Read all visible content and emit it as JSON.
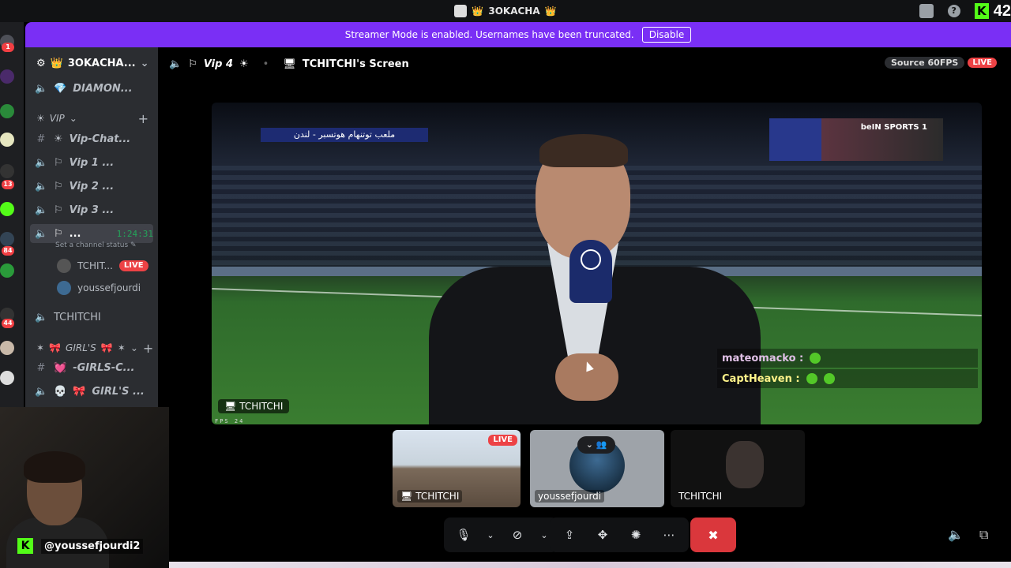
{
  "app": {
    "title": "3OKACHA",
    "notification_count": "42"
  },
  "banner": {
    "message": "Streamer Mode is enabled. Usernames have been truncated.",
    "disable_label": "Disable"
  },
  "guild_rail": {
    "badges": [
      "1",
      "13",
      "84",
      "44"
    ]
  },
  "sidebar": {
    "server_name": "3OKACHA...",
    "channels": [
      {
        "label": "DIAMON...",
        "icon": "speaker-icon"
      },
      {
        "label": "Vip-Chat...",
        "icon": "hash-icon"
      },
      {
        "label": "Vip 1 ...",
        "icon": "speaker-icon"
      },
      {
        "label": "Vip 2 ...",
        "icon": "speaker-icon"
      },
      {
        "label": "Vip 3 ...",
        "icon": "speaker-icon"
      },
      {
        "label": "...",
        "icon": "speaker-icon",
        "timer": "1:24:31"
      },
      {
        "label": "TCHITCHI",
        "icon": "speaker-icon"
      },
      {
        "label": "-GIRLS-C...",
        "icon": "hash-icon"
      },
      {
        "label": "GIRL'S ...",
        "icon": "speaker-icon"
      }
    ],
    "categories": [
      "VIP",
      "GIRL'S"
    ],
    "channel_status": "Set a channel status",
    "voice_users": [
      {
        "name": "TCHIT...",
        "live": "LIVE"
      },
      {
        "name": "youssefjourdi"
      }
    ]
  },
  "stage": {
    "channel": "Vip 4",
    "screen_title": "TCHITCHI's Screen",
    "quality": "Source 60FPS",
    "live_label": "LIVE"
  },
  "video": {
    "caption": "ملعب توتنهام هوتسبر - لندن",
    "tv_logo": "beIN SPORTS 1",
    "tag": "TCHITCHI",
    "fps_label": "FPS 24",
    "chat": [
      {
        "user": "mateomacko :"
      },
      {
        "user": "CaptHeaven :"
      }
    ]
  },
  "tiles": [
    {
      "name": "TCHITCHI",
      "live": "LIVE"
    },
    {
      "name": "youssefjourdi"
    },
    {
      "name": "TCHITCHI"
    }
  ],
  "webcam": {
    "handle": "@youssefjourdi2"
  },
  "colors": {
    "banner": "#7a2ff5",
    "live": "#ed4245",
    "leave": "#da373c",
    "kick": "#53fc18"
  }
}
